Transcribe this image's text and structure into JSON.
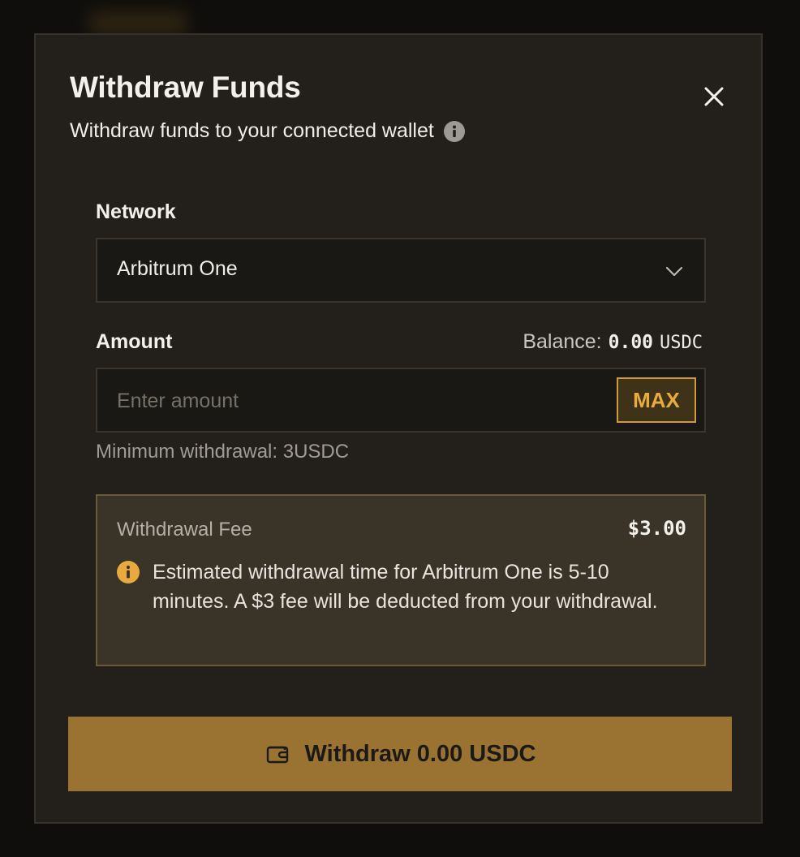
{
  "modal": {
    "title": "Withdraw Funds",
    "subtitle": "Withdraw funds to your connected wallet"
  },
  "network": {
    "label": "Network",
    "selected": "Arbitrum One"
  },
  "amount": {
    "label": "Amount",
    "balance_label": "Balance:",
    "balance_value": "0.00",
    "balance_unit": "USDC",
    "placeholder": "Enter amount",
    "max_label": "MAX",
    "minimum_note": "Minimum withdrawal: 3USDC"
  },
  "fee": {
    "label": "Withdrawal Fee",
    "value": "$3.00",
    "notice": "Estimated withdrawal time for Arbitrum One is 5-10 minutes. A $3 fee will be deducted from your withdrawal."
  },
  "submit": {
    "label": "Withdraw 0.00 USDC"
  },
  "icons": {
    "close": "close-icon",
    "subtitle_info": "info-icon",
    "network_dropdown": "chevron-down-icon",
    "notice": "info-icon",
    "submit": "wallet-icon"
  },
  "colors": {
    "accent": "#9a7332",
    "max_accent": "#e8ab3f",
    "fee_box_bg": "#3a3327",
    "modal_bg": "#23201b"
  }
}
